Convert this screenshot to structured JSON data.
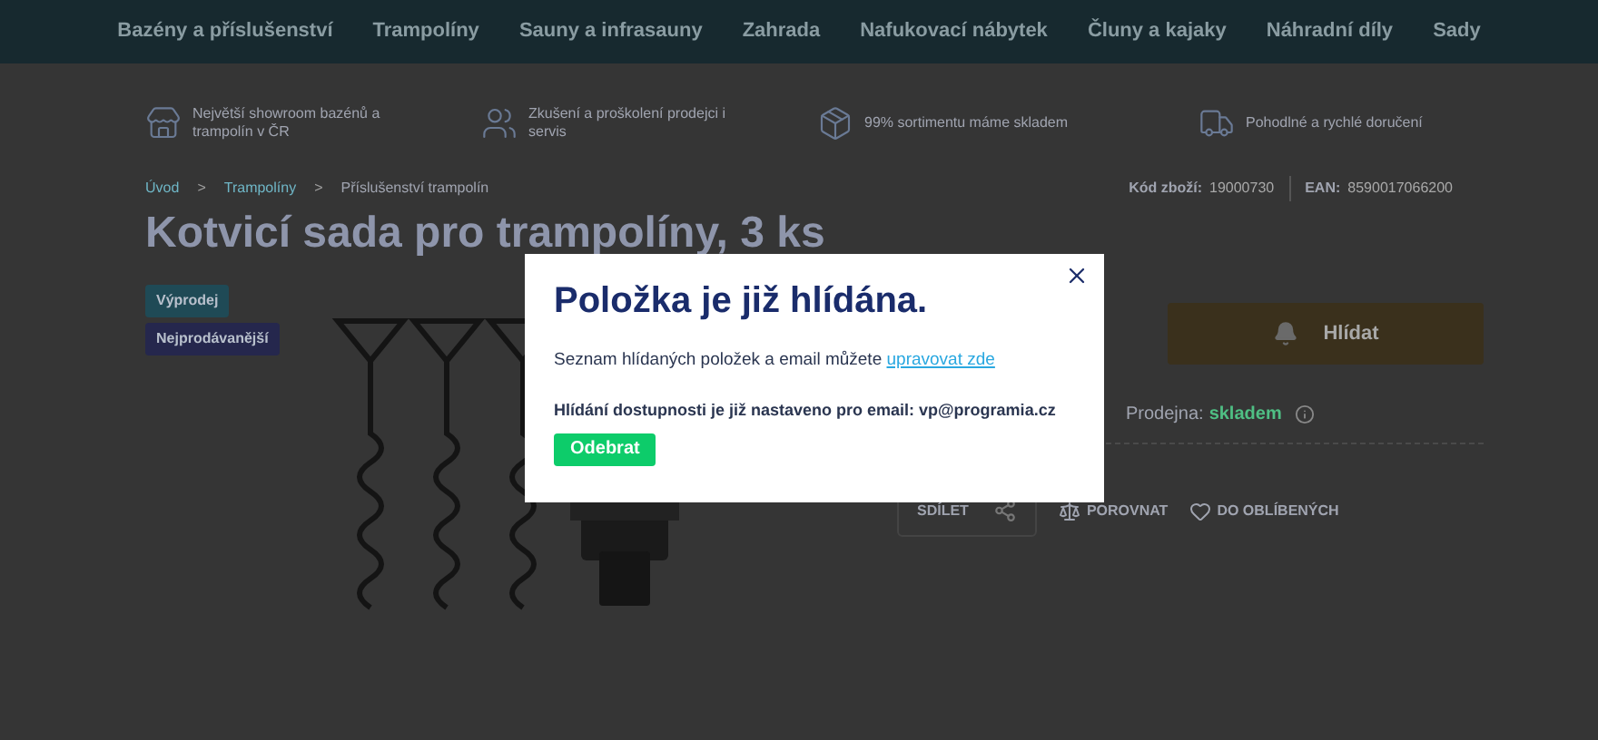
{
  "nav": {
    "items": [
      "Bazény a příslušenství",
      "Trampolíny",
      "Sauny a infrasauny",
      "Zahrada",
      "Nafukovací nábytek",
      "Čluny a kajaky",
      "Náhradní díly",
      "Sady"
    ]
  },
  "features": [
    {
      "kind": "store",
      "text": "Největší showroom bazénů a trampolín v ČR"
    },
    {
      "kind": "people",
      "text": "Zkušení a proškolení prodejci i servis"
    },
    {
      "kind": "box",
      "text": "99% sortimentu máme skladem"
    },
    {
      "kind": "truck",
      "text": "Pohodlné a rychlé doručení"
    }
  ],
  "breadcrumb": [
    {
      "text": "Úvod",
      "separator": ">"
    },
    {
      "text": "Trampolíny",
      "separator": ">"
    },
    {
      "text": "Příslušenství trampolín"
    }
  ],
  "codes": [
    {
      "label": "Kód zboží:",
      "value": "19000730"
    },
    {
      "label": "EAN:",
      "value": "8590017066200"
    }
  ],
  "product": {
    "title": "Kotvicí sada pro trampolíny, 3 ks",
    "badges": [
      {
        "text": "Výprodej",
        "color": "#1f4a56"
      },
      {
        "text": "Nejprodávanější",
        "color": "#25274d"
      }
    ]
  },
  "actions": {
    "watch_button": "Hlídat",
    "store_label": "Prodejna:",
    "store_status": "skladem",
    "share": "SDÍLET",
    "compare": "POROVNAT",
    "favorite": "DO OBLÍBENÝCH"
  },
  "modal": {
    "title": "Položka je již hlídána.",
    "text": "Seznam hlídaných položek a email můžete",
    "link": "upravovat zde",
    "info": "Hlídání dostupnosti je již nastaveno pro email: vp@programia.cz",
    "button": "Odebrat"
  }
}
